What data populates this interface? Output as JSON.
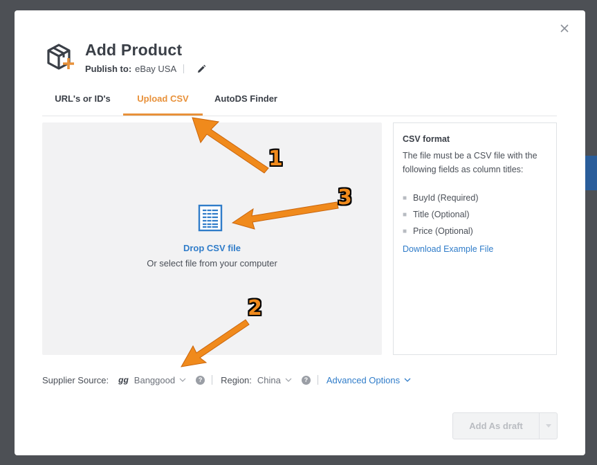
{
  "modal": {
    "title": "Add Product",
    "publish_label": "Publish to:",
    "publish_value": "eBay USA"
  },
  "tabs": [
    {
      "label": "URL's or ID's",
      "active": false
    },
    {
      "label": "Upload CSV",
      "active": true
    },
    {
      "label": "AutoDS Finder",
      "active": false
    }
  ],
  "dropzone": {
    "title": "Drop CSV file",
    "subtitle": "Or select file from your computer"
  },
  "csv_info": {
    "title": "CSV format",
    "description": "The file must be a CSV file with the following fields as column titles:",
    "fields": [
      "BuyId (Required)",
      "Title (Optional)",
      "Price (Optional)"
    ],
    "download_link": "Download Example File"
  },
  "options": {
    "supplier_label": "Supplier Source:",
    "supplier_logo": "gg",
    "supplier_value": "Banggood",
    "region_label": "Region:",
    "region_value": "China",
    "advanced_label": "Advanced Options"
  },
  "footer": {
    "add_draft_label": "Add As draft"
  },
  "annotations": {
    "labels": [
      "1",
      "2",
      "3"
    ]
  },
  "colors": {
    "accent": "#e8913a",
    "link": "#2f7cc9",
    "annotation_arrow": "#f08a1c"
  }
}
